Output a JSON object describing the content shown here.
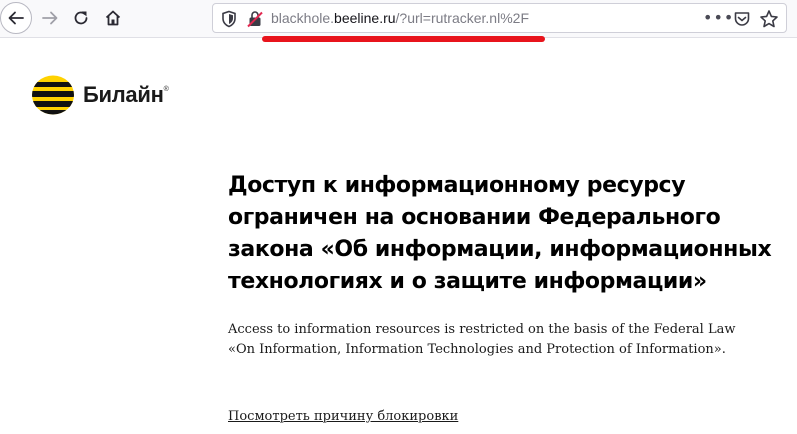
{
  "browser": {
    "url": {
      "prefix": "blackhole.",
      "domain": "beeline.ru",
      "path": "/?url=rutracker.nl%2F"
    },
    "highlight_color": "#e8141c"
  },
  "brand": {
    "name": "Билайн",
    "reg_mark": "®",
    "colors": {
      "yellow": "#ffd200",
      "black": "#111111"
    }
  },
  "main": {
    "heading_lines": [
      "Доступ к информационному ресурсу",
      "ограничен на основании Федерального",
      "закона «Об информации, информационных",
      "технологиях и о защите информации»"
    ],
    "subtext_lines": [
      "Access to information resources is restricted on the basis of the Federal Law",
      "«On Information, Information Technologies and Protection of Information»."
    ],
    "reason_link": "Посмотреть причину блокировки"
  }
}
